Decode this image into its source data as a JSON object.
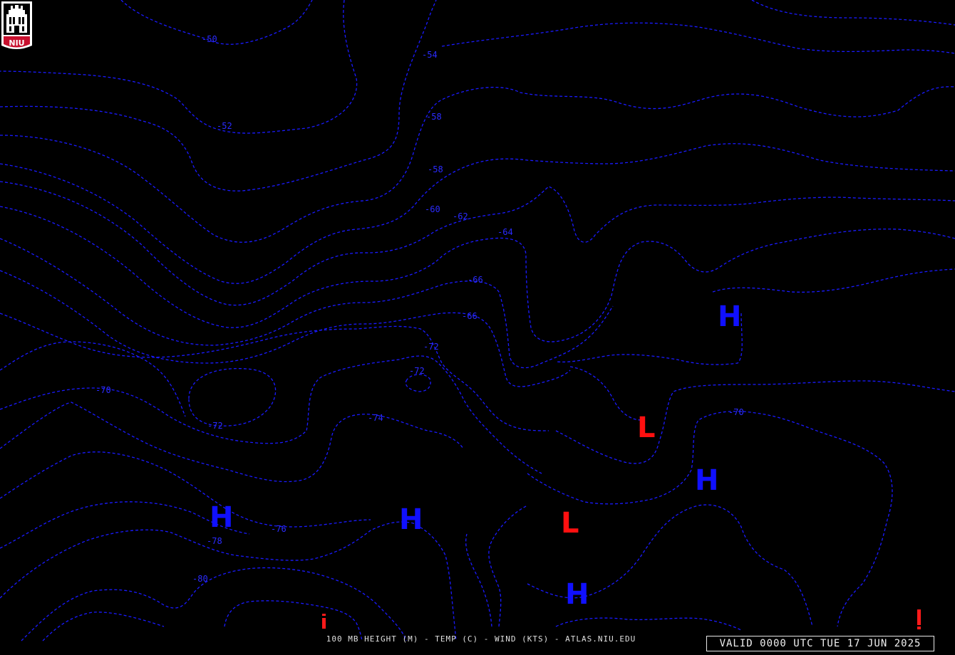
{
  "map": {
    "level": "100 MB",
    "contour_color": "#1a1aff",
    "high_color": "#1010ff",
    "low_color": "#ff1010",
    "contour_labels": [
      "-50",
      "-54",
      "-52",
      "-58",
      "-58",
      "-60",
      "-62",
      "-64",
      "-66",
      "-66",
      "-72",
      "-72",
      "-70",
      "-72",
      "-74",
      "-70",
      "-76",
      "-78",
      "-80"
    ],
    "pressure_centers": {
      "h1": "H",
      "h2": "H",
      "h3": "H",
      "h4": "H",
      "h5": "H",
      "l1": "L",
      "l2": "L"
    }
  },
  "footer": {
    "caption": "100 MB HEIGHT (M) - TEMP (C) - WIND (KTS) - ATLAS.NIU.EDU",
    "valid": "VALID 0000 UTC TUE 17 JUN 2025"
  },
  "logo": {
    "text": "NIU",
    "accent": "#c8102e"
  }
}
